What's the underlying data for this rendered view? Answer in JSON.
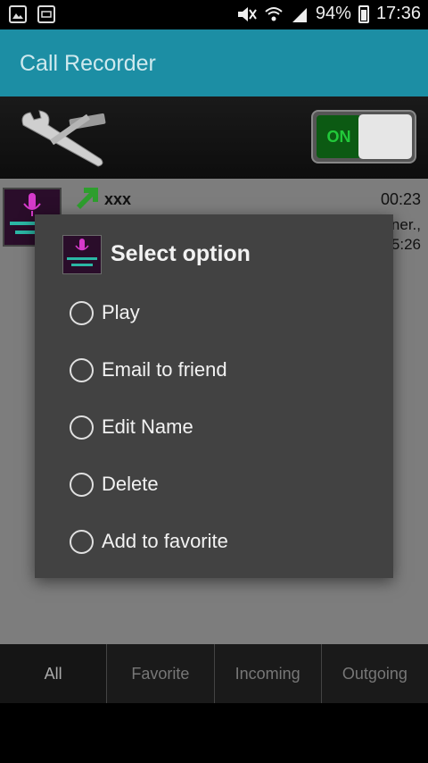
{
  "status_bar": {
    "battery": "94%",
    "time": "17:36",
    "icons": [
      "gallery-icon",
      "screen-icon",
      "mute-icon",
      "wifi-icon",
      "signal-icon",
      "battery-icon"
    ]
  },
  "app_bar": {
    "title": "Call Recorder"
  },
  "control_strip": {
    "tools_icon": "wrench-hammer-icon",
    "toggle_label": "ON"
  },
  "list": {
    "rows": [
      {
        "name": "xxx",
        "duration": "00:23",
        "sub1": "ner.,",
        "sub2": "5:26",
        "direction_icon": "outgoing-arrow-icon"
      }
    ]
  },
  "dialog": {
    "title": "Select option",
    "options": [
      {
        "label": "Play"
      },
      {
        "label": "Email to friend"
      },
      {
        "label": "Edit Name"
      },
      {
        "label": "Delete"
      },
      {
        "label": "Add to favorite"
      }
    ]
  },
  "tabs": [
    {
      "label": "All"
    },
    {
      "label": "Favorite"
    },
    {
      "label": "Incoming"
    },
    {
      "label": "Outgoing"
    }
  ],
  "colors": {
    "app_bar": "#1c8ea4",
    "dialog_bg": "#424242",
    "toggle_on": "#22c93a"
  }
}
